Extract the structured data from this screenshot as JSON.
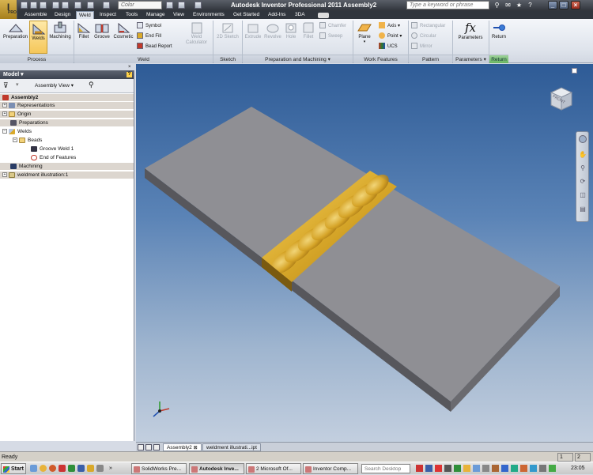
{
  "app": {
    "title": "Autodesk Inventor Professional 2011    Assembly2",
    "logo_letter": "I",
    "logo_sub": "PRO",
    "color_placeholder": "Color",
    "search_placeholder": "Type a keyword or phrase",
    "tabs": [
      "Assemble",
      "Design",
      "Weld",
      "Inspect",
      "Tools",
      "Manage",
      "View",
      "Environments",
      "Get Started",
      "Add-Ins",
      "3DA"
    ],
    "active_tab": "Weld"
  },
  "ribbon": {
    "process": {
      "label": "Process",
      "buttons": [
        "Preparation",
        "Welds",
        "Machining"
      ]
    },
    "weld": {
      "label": "Weld",
      "buttons": [
        "Fillet",
        "Groove",
        "Cosmetic"
      ],
      "small": [
        "Symbol",
        "End Fill",
        "Bead Report"
      ],
      "calculator": "Weld Calculator"
    },
    "sketch": {
      "label": "Sketch",
      "buttons": [
        "2D Sketch"
      ]
    },
    "prep_machining": {
      "label": "Preparation and Machining",
      "buttons": [
        "Extrude",
        "Revolve",
        "Hole",
        "Fillet"
      ],
      "small": [
        "Chamfer",
        "Sweep"
      ]
    },
    "work_features": {
      "label": "Work Features",
      "plane": "Plane",
      "small": [
        "Axis",
        "Point",
        "UCS"
      ]
    },
    "pattern": {
      "label": "Pattern",
      "small": [
        "Rectangular",
        "Circular",
        "Mirror"
      ]
    },
    "parameters": {
      "label": "Parameters",
      "button": "Parameters"
    },
    "return": {
      "label": "Return",
      "button": "Return"
    }
  },
  "browser": {
    "title": "Model",
    "help": "?",
    "view_label": "Assembly View",
    "tree": [
      "Assembly2",
      "Representations",
      "Origin",
      "Preparations",
      "Welds",
      "Beads",
      "Groove Weld 1",
      "End of Features",
      "Machining",
      "weldment illustration:1"
    ]
  },
  "doc_tabs": [
    "Assembly2",
    "weldment illustrati...ipt"
  ],
  "viewcube": {
    "face": "FRONT"
  },
  "status": {
    "text": "Ready",
    "count_a": "1",
    "count_b": "2"
  },
  "taskbar": {
    "start": "Start",
    "items": [
      "SolidWorks Pre...",
      "Autodesk Inve...",
      "2 Microsoft Of...",
      "Inventor Comp..."
    ],
    "search_placeholder": "Search Desktop",
    "clock": "23:05"
  },
  "colors": {
    "accent": "#f5c75a",
    "plate_top": "#8f8f94",
    "plate_side": "#56565b",
    "weld_bead": "#d9a92a"
  }
}
